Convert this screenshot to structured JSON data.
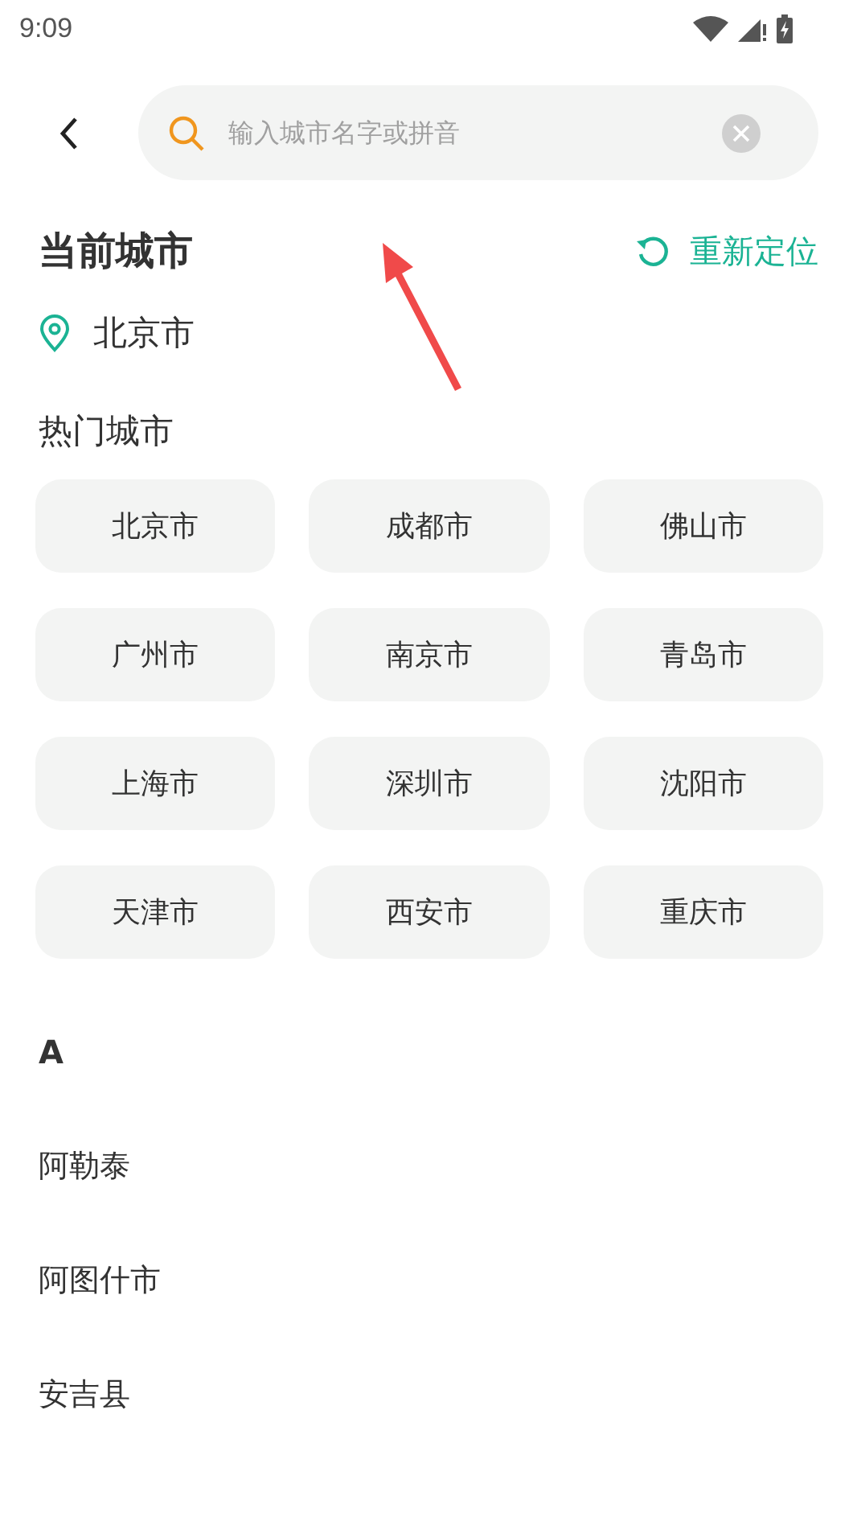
{
  "status_bar": {
    "time": "9:09"
  },
  "search": {
    "placeholder": "输入城市名字或拼音"
  },
  "current_city": {
    "title": "当前城市",
    "relocate": "重新定位",
    "city": "北京市"
  },
  "hot_cities": {
    "title": "热门城市",
    "items": [
      "北京市",
      "成都市",
      "佛山市",
      "广州市",
      "南京市",
      "青岛市",
      "上海市",
      "深圳市",
      "沈阳市",
      "天津市",
      "西安市",
      "重庆市"
    ]
  },
  "sections": [
    {
      "letter": "A",
      "cities": [
        "阿勒泰",
        "阿图什市",
        "安吉县"
      ]
    }
  ],
  "annotation": {
    "kind": "arrow"
  }
}
